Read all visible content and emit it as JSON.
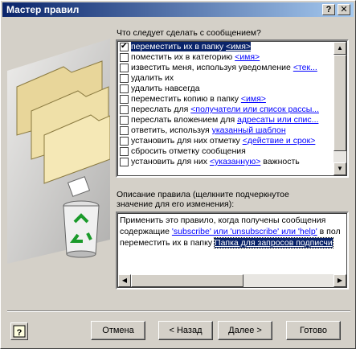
{
  "window": {
    "title": "Мастер правил",
    "help_btn": "?",
    "close_btn": "✕"
  },
  "conditions": {
    "prompt": "Что следует сделать с сообщением?",
    "items": [
      {
        "checked": true,
        "selected": true,
        "pre": "переместить их в папку ",
        "link": "<имя>",
        "post": ""
      },
      {
        "checked": false,
        "selected": false,
        "pre": "поместить их в категорию ",
        "link": "<имя>",
        "post": ""
      },
      {
        "checked": false,
        "selected": false,
        "pre": "известить меня, используя уведомление ",
        "link": "<тек...",
        "post": ""
      },
      {
        "checked": false,
        "selected": false,
        "pre": "удалить их",
        "link": "",
        "post": ""
      },
      {
        "checked": false,
        "selected": false,
        "pre": "удалить навсегда",
        "link": "",
        "post": ""
      },
      {
        "checked": false,
        "selected": false,
        "pre": "переместить копию в папку ",
        "link": "<имя>",
        "post": ""
      },
      {
        "checked": false,
        "selected": false,
        "pre": "переслать для ",
        "link": "<получатели или список рассы...",
        "post": ""
      },
      {
        "checked": false,
        "selected": false,
        "pre": "переслать вложением для ",
        "link": "адресаты или спис...",
        "post": ""
      },
      {
        "checked": false,
        "selected": false,
        "pre": "ответить, используя ",
        "link": "указанный шаблон",
        "post": ""
      },
      {
        "checked": false,
        "selected": false,
        "pre": "установить для них отметку ",
        "link": "<действие и срок>",
        "post": ""
      },
      {
        "checked": false,
        "selected": false,
        "pre": "сбросить отметку сообщения",
        "link": "",
        "post": ""
      },
      {
        "checked": false,
        "selected": false,
        "pre": "установить для них ",
        "link": "<указанную>",
        "post": " важность"
      }
    ]
  },
  "description": {
    "label_line1": "Описание правила (щелкните подчеркнутое",
    "label_line2": "значение для его изменения):",
    "line1": "Применить это правило, когда получены сообщения",
    "line2_pre": "содержащие ",
    "line2_link": "'subscribe' или 'unsubscribe' или 'help'",
    "line2_post": " в пол",
    "line3_pre": "переместить их в папку ",
    "line3_link": "Папка для запросов подписчи"
  },
  "buttons": {
    "cancel": "Отмена",
    "back": "< Назад",
    "next": "Далее >",
    "finish": "Готово"
  }
}
